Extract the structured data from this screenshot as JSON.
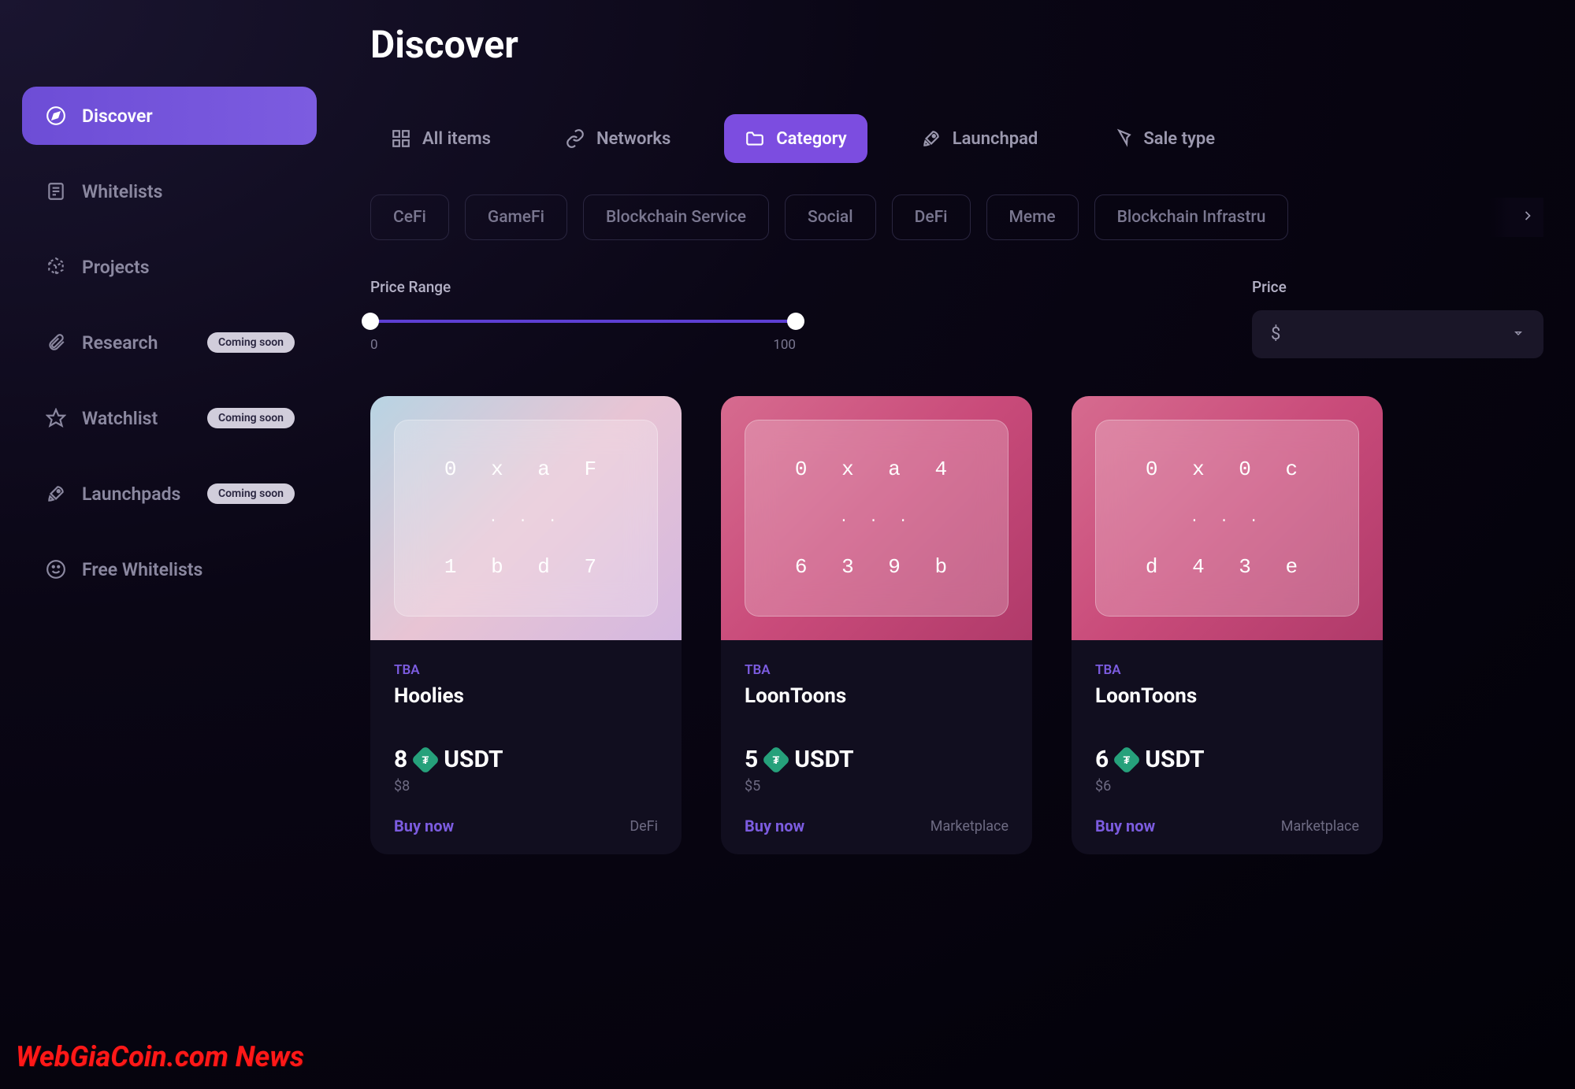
{
  "page_title": "Discover",
  "sidebar": [
    {
      "label": "Discover",
      "active": true,
      "icon": "compass",
      "badge": null
    },
    {
      "label": "Whitelists",
      "active": false,
      "icon": "list",
      "badge": null
    },
    {
      "label": "Projects",
      "active": false,
      "icon": "cube",
      "badge": null
    },
    {
      "label": "Research",
      "active": false,
      "icon": "clip",
      "badge": "Coming soon"
    },
    {
      "label": "Watchlist",
      "active": false,
      "icon": "star",
      "badge": "Coming soon"
    },
    {
      "label": "Launchpads",
      "active": false,
      "icon": "rocket",
      "badge": "Coming soon"
    },
    {
      "label": "Free Whitelists",
      "active": false,
      "icon": "smile",
      "badge": null
    }
  ],
  "filters": [
    {
      "label": "All items",
      "icon": "grid",
      "active": false
    },
    {
      "label": "Networks",
      "icon": "link",
      "active": false
    },
    {
      "label": "Category",
      "icon": "folder",
      "active": true
    },
    {
      "label": "Launchpad",
      "icon": "rocket",
      "active": false
    },
    {
      "label": "Sale type",
      "icon": "cursor",
      "active": false
    }
  ],
  "chips": [
    "CeFi",
    "GameFi",
    "Blockchain Service",
    "Social",
    "DeFi",
    "Meme",
    "Blockchain Infrastru"
  ],
  "price_range": {
    "label": "Price Range",
    "min": "0",
    "max": "100"
  },
  "price_select": {
    "label": "Price",
    "value": "$"
  },
  "cards": [
    {
      "addr_top": "0 x a F",
      "addr_bot": "1 b d 7",
      "status": "TBA",
      "name": "Hoolies",
      "amount": "8",
      "currency": "USDT",
      "fiat": "$8",
      "action": "Buy now",
      "tag": "DeFi",
      "bg": "hoolies"
    },
    {
      "addr_top": "0 x a 4",
      "addr_bot": "6 3 9 b",
      "status": "TBA",
      "name": "LoonToons",
      "amount": "5",
      "currency": "USDT",
      "fiat": "$5",
      "action": "Buy now",
      "tag": "Marketplace",
      "bg": "loon"
    },
    {
      "addr_top": "0 x 0 c",
      "addr_bot": "d 4 3 e",
      "status": "TBA",
      "name": "LoonToons",
      "amount": "6",
      "currency": "USDT",
      "fiat": "$6",
      "action": "Buy now",
      "tag": "Marketplace",
      "bg": "loon"
    }
  ],
  "watermark": "WebGiaCoin.com News"
}
